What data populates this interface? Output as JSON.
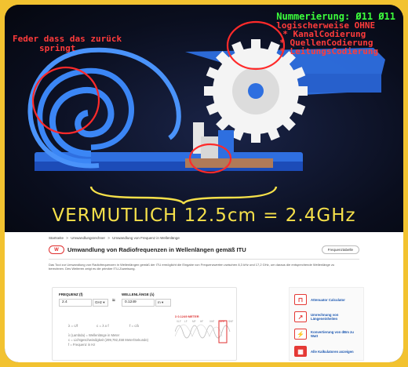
{
  "annotations": {
    "left_note": [
      "Feder dass das zurück",
      "springt"
    ],
    "right_title": "Nummerierung: Ø11 Ø11",
    "right_lines": [
      "logischerweise OHNE",
      "* KanalCodierung",
      "* QuellenCodierung",
      "* LeitungsCodierung"
    ],
    "headline": "VERMUTLICH 12.5cm = 2.4GHz"
  },
  "page": {
    "breadcrumbs": [
      "Startseite",
      ">",
      "Umwandlungsrechner",
      ">",
      "Umwandlung von Frequenz in Wellenlänge"
    ],
    "logo_text": "W",
    "title": "Umwandlung von Radiofrequenzen in Wellenlängen gemäß ITU",
    "tab_button": "Frequenztabelle",
    "intro": "Das Tool zur Umwandlung von Radiofrequenzen in Wellenlängen gemäß der ITU ermöglicht die Eingabe von Frequenzwerten zwischen 8,3 kHz und 17,2 GHz, um daraus die entsprechende Wellenlänge zu berechnen. Des Weiteren zeigt es die primäre ITU-Zuweisung."
  },
  "calculator": {
    "freq_label": "FREQUENZ (f)",
    "freq_value": "2.4",
    "freq_unit": "GHz",
    "approx": "≈",
    "wave_label": "WELLENLÄNGE (λ)",
    "wave_value": "0.1249",
    "wave_unit": "m",
    "formulas": [
      "λ = c/f",
      "c = λ x f",
      "f = c/λ"
    ],
    "legend": [
      "λ (Lambda) = Wellenlänge in Meter",
      "c = Lichtgeschwindigkeit (299,792,458 Meter/Sekunde)",
      "f = Frequenz in Hz"
    ],
    "band_title": "λ 0.1249 METER",
    "band_labels": [
      "VLF",
      "LF",
      "MF",
      "HF",
      "VHF",
      "UHF",
      "SHF"
    ],
    "band_selected": "UHF"
  },
  "sidebar": [
    {
      "label": "Attenuator Calculator",
      "icon": "attenuator-icon",
      "color": "#e53935"
    },
    {
      "label": "Umrechnung von Längeneinheiten",
      "icon": "ruler-icon",
      "color": "#e53935"
    },
    {
      "label": "Konvertierung von dBm zu Watt",
      "icon": "dbm-icon",
      "color": "#e53935"
    },
    {
      "label": "Alle Kalkulatoren anzeigen",
      "icon": "calculator-icon",
      "color": "#e53935"
    }
  ]
}
